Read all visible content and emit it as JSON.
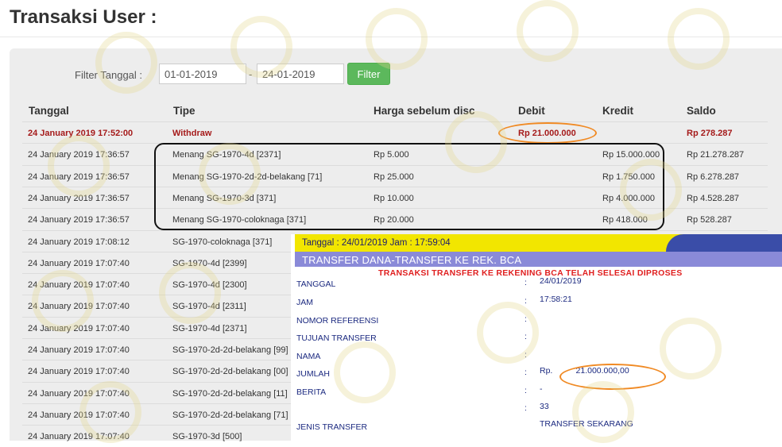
{
  "page": {
    "title": "Transaksi User :"
  },
  "filter": {
    "label": "Filter Tanggal :",
    "from": "01-01-2019",
    "separator": "-",
    "to": "24-01-2019",
    "button": "Filter"
  },
  "table": {
    "headers": [
      "Tanggal",
      "Tipe",
      "Harga sebelum disc",
      "Debit",
      "Kredit",
      "Saldo"
    ],
    "rows": [
      [
        "24 January 2019 17:52:00",
        "Withdraw",
        "",
        "Rp 21.000.000",
        "",
        "Rp 278.287"
      ],
      [
        "24 January 2019 17:36:57",
        "Menang SG-1970-4d [2371]",
        "Rp 5.000",
        "",
        "Rp 15.000.000",
        "Rp 21.278.287"
      ],
      [
        "24 January 2019 17:36:57",
        "Menang SG-1970-2d-2d-belakang [71]",
        "Rp 25.000",
        "",
        "Rp 1.750.000",
        "Rp 6.278.287"
      ],
      [
        "24 January 2019 17:36:57",
        "Menang SG-1970-3d [371]",
        "Rp 10.000",
        "",
        "Rp 4.000.000",
        "Rp 4.528.287"
      ],
      [
        "24 January 2019 17:36:57",
        "Menang SG-1970-coloknaga [371]",
        "Rp 20.000",
        "",
        "Rp 418.000",
        "Rp 528.287"
      ],
      [
        "24 January 2019 17:08:12",
        "SG-1970-coloknaga [371]",
        "",
        "",
        "",
        ""
      ],
      [
        "24 January 2019 17:07:40",
        "SG-1970-4d [2399]",
        "",
        "",
        "",
        ""
      ],
      [
        "24 January 2019 17:07:40",
        "SG-1970-4d [2300]",
        "",
        "",
        "",
        ""
      ],
      [
        "24 January 2019 17:07:40",
        "SG-1970-4d [2311]",
        "",
        "",
        "",
        ""
      ],
      [
        "24 January 2019 17:07:40",
        "SG-1970-4d [2371]",
        "",
        "",
        "",
        ""
      ],
      [
        "24 January 2019 17:07:40",
        "SG-1970-2d-2d-belakang [99]",
        "",
        "",
        "",
        ""
      ],
      [
        "24 January 2019 17:07:40",
        "SG-1970-2d-2d-belakang [00]",
        "",
        "",
        "",
        ""
      ],
      [
        "24 January 2019 17:07:40",
        "SG-1970-2d-2d-belakang [11]",
        "",
        "",
        "",
        ""
      ],
      [
        "24 January 2019 17:07:40",
        "SG-1970-2d-2d-belakang [71]",
        "",
        "",
        "",
        ""
      ],
      [
        "24 January 2019 17:07:40",
        "SG-1970-3d [500]",
        "",
        "",
        "",
        ""
      ]
    ]
  },
  "transfer": {
    "header_date": "Tanggal : 24/01/2019 Jam : 17:59:04",
    "title": "TRANSFER DANA-TRANSFER KE REK. BCA",
    "status": "TRANSAKSI TRANSFER KE REKENING BCA TELAH SELESAI DIPROSES",
    "colon": ":",
    "fields": [
      {
        "label": "TANGGAL",
        "value": "24/01/2019"
      },
      {
        "label": "JAM",
        "value": "17:58:21"
      },
      {
        "label": "NOMOR REFERENSI",
        "value": ""
      },
      {
        "label": "TUJUAN TRANSFER",
        "value": ""
      },
      {
        "label": "NAMA",
        "value": ""
      },
      {
        "label": "JUMLAH",
        "value": "Rp.          21.000.000,00"
      },
      {
        "label": "BERITA",
        "value": "-"
      },
      {
        "label": "",
        "value": "33"
      },
      {
        "label": "JENIS TRANSFER",
        "value": "TRANSFER SEKARANG"
      }
    ]
  },
  "colors": {
    "accent": "#5cb85c",
    "highlight_text": "#a51a1a",
    "oval": "#f08a24",
    "bca_yellow": "#f2e600",
    "bca_navy": "#3a4da8"
  }
}
